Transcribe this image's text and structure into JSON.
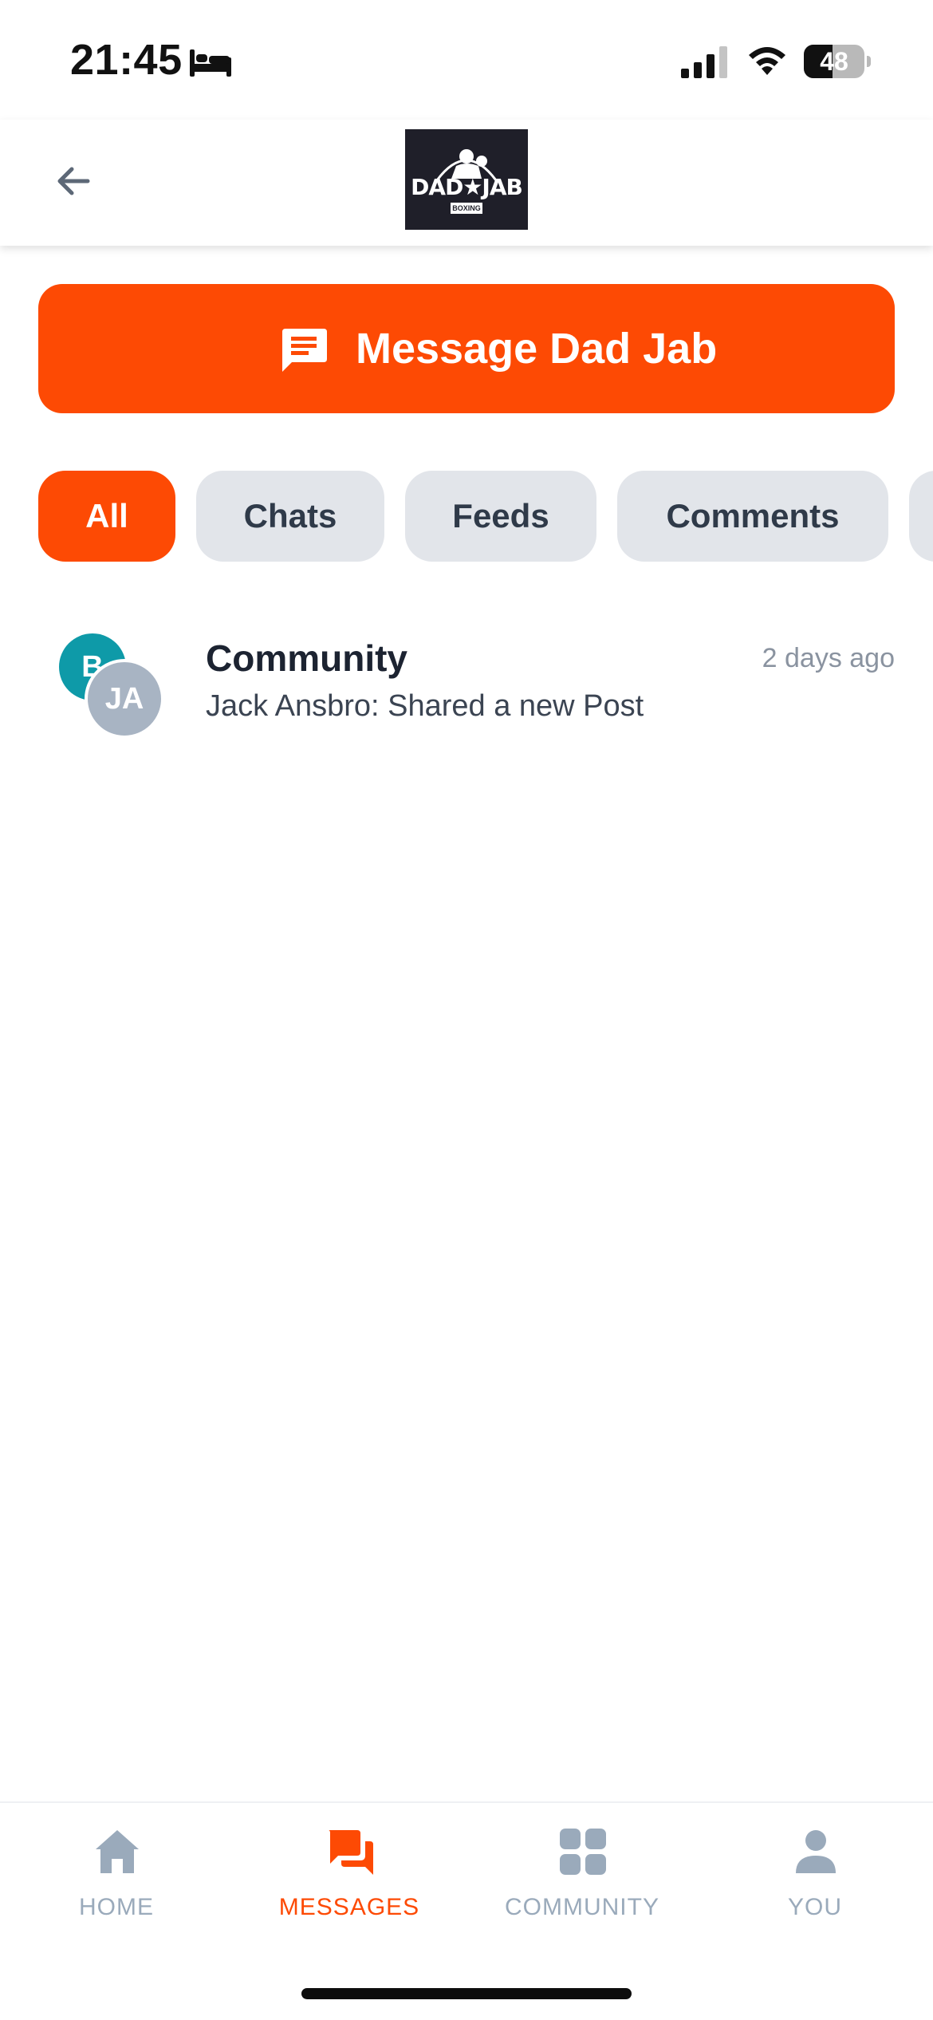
{
  "status_bar": {
    "time": "21:45",
    "battery_level": "48",
    "battery_fraction": 0.48
  },
  "header": {
    "back_icon": "arrow-left-icon",
    "logo": {
      "main_text": "DAD★JAB",
      "sub_text": "BOXING"
    }
  },
  "message_button": {
    "label": "Message Dad Jab",
    "icon": "chat-bubble-icon"
  },
  "tabs": [
    {
      "label": "All",
      "active": true
    },
    {
      "label": "Chats",
      "active": false
    },
    {
      "label": "Feeds",
      "active": false
    },
    {
      "label": "Comments",
      "active": false
    }
  ],
  "conversations": [
    {
      "title": "Community",
      "preview": "Jack Ansbro: Shared a new Post",
      "time": "2 days ago",
      "avatar_back_initial": "B",
      "avatar_front_initials": "JA"
    }
  ],
  "bottom_nav": [
    {
      "label": "HOME",
      "icon": "home-icon",
      "active": false
    },
    {
      "label": "MESSAGES",
      "icon": "messages-icon",
      "active": true
    },
    {
      "label": "COMMUNITY",
      "icon": "grid-icon",
      "active": false
    },
    {
      "label": "YOU",
      "icon": "user-icon",
      "active": false
    }
  ],
  "colors": {
    "accent": "#fd4a04",
    "tab_inactive_bg": "#e2e5ea",
    "nav_inactive": "#9aaabb",
    "avatar_teal": "#0e9aa8",
    "avatar_gray": "#a8b4c3"
  }
}
